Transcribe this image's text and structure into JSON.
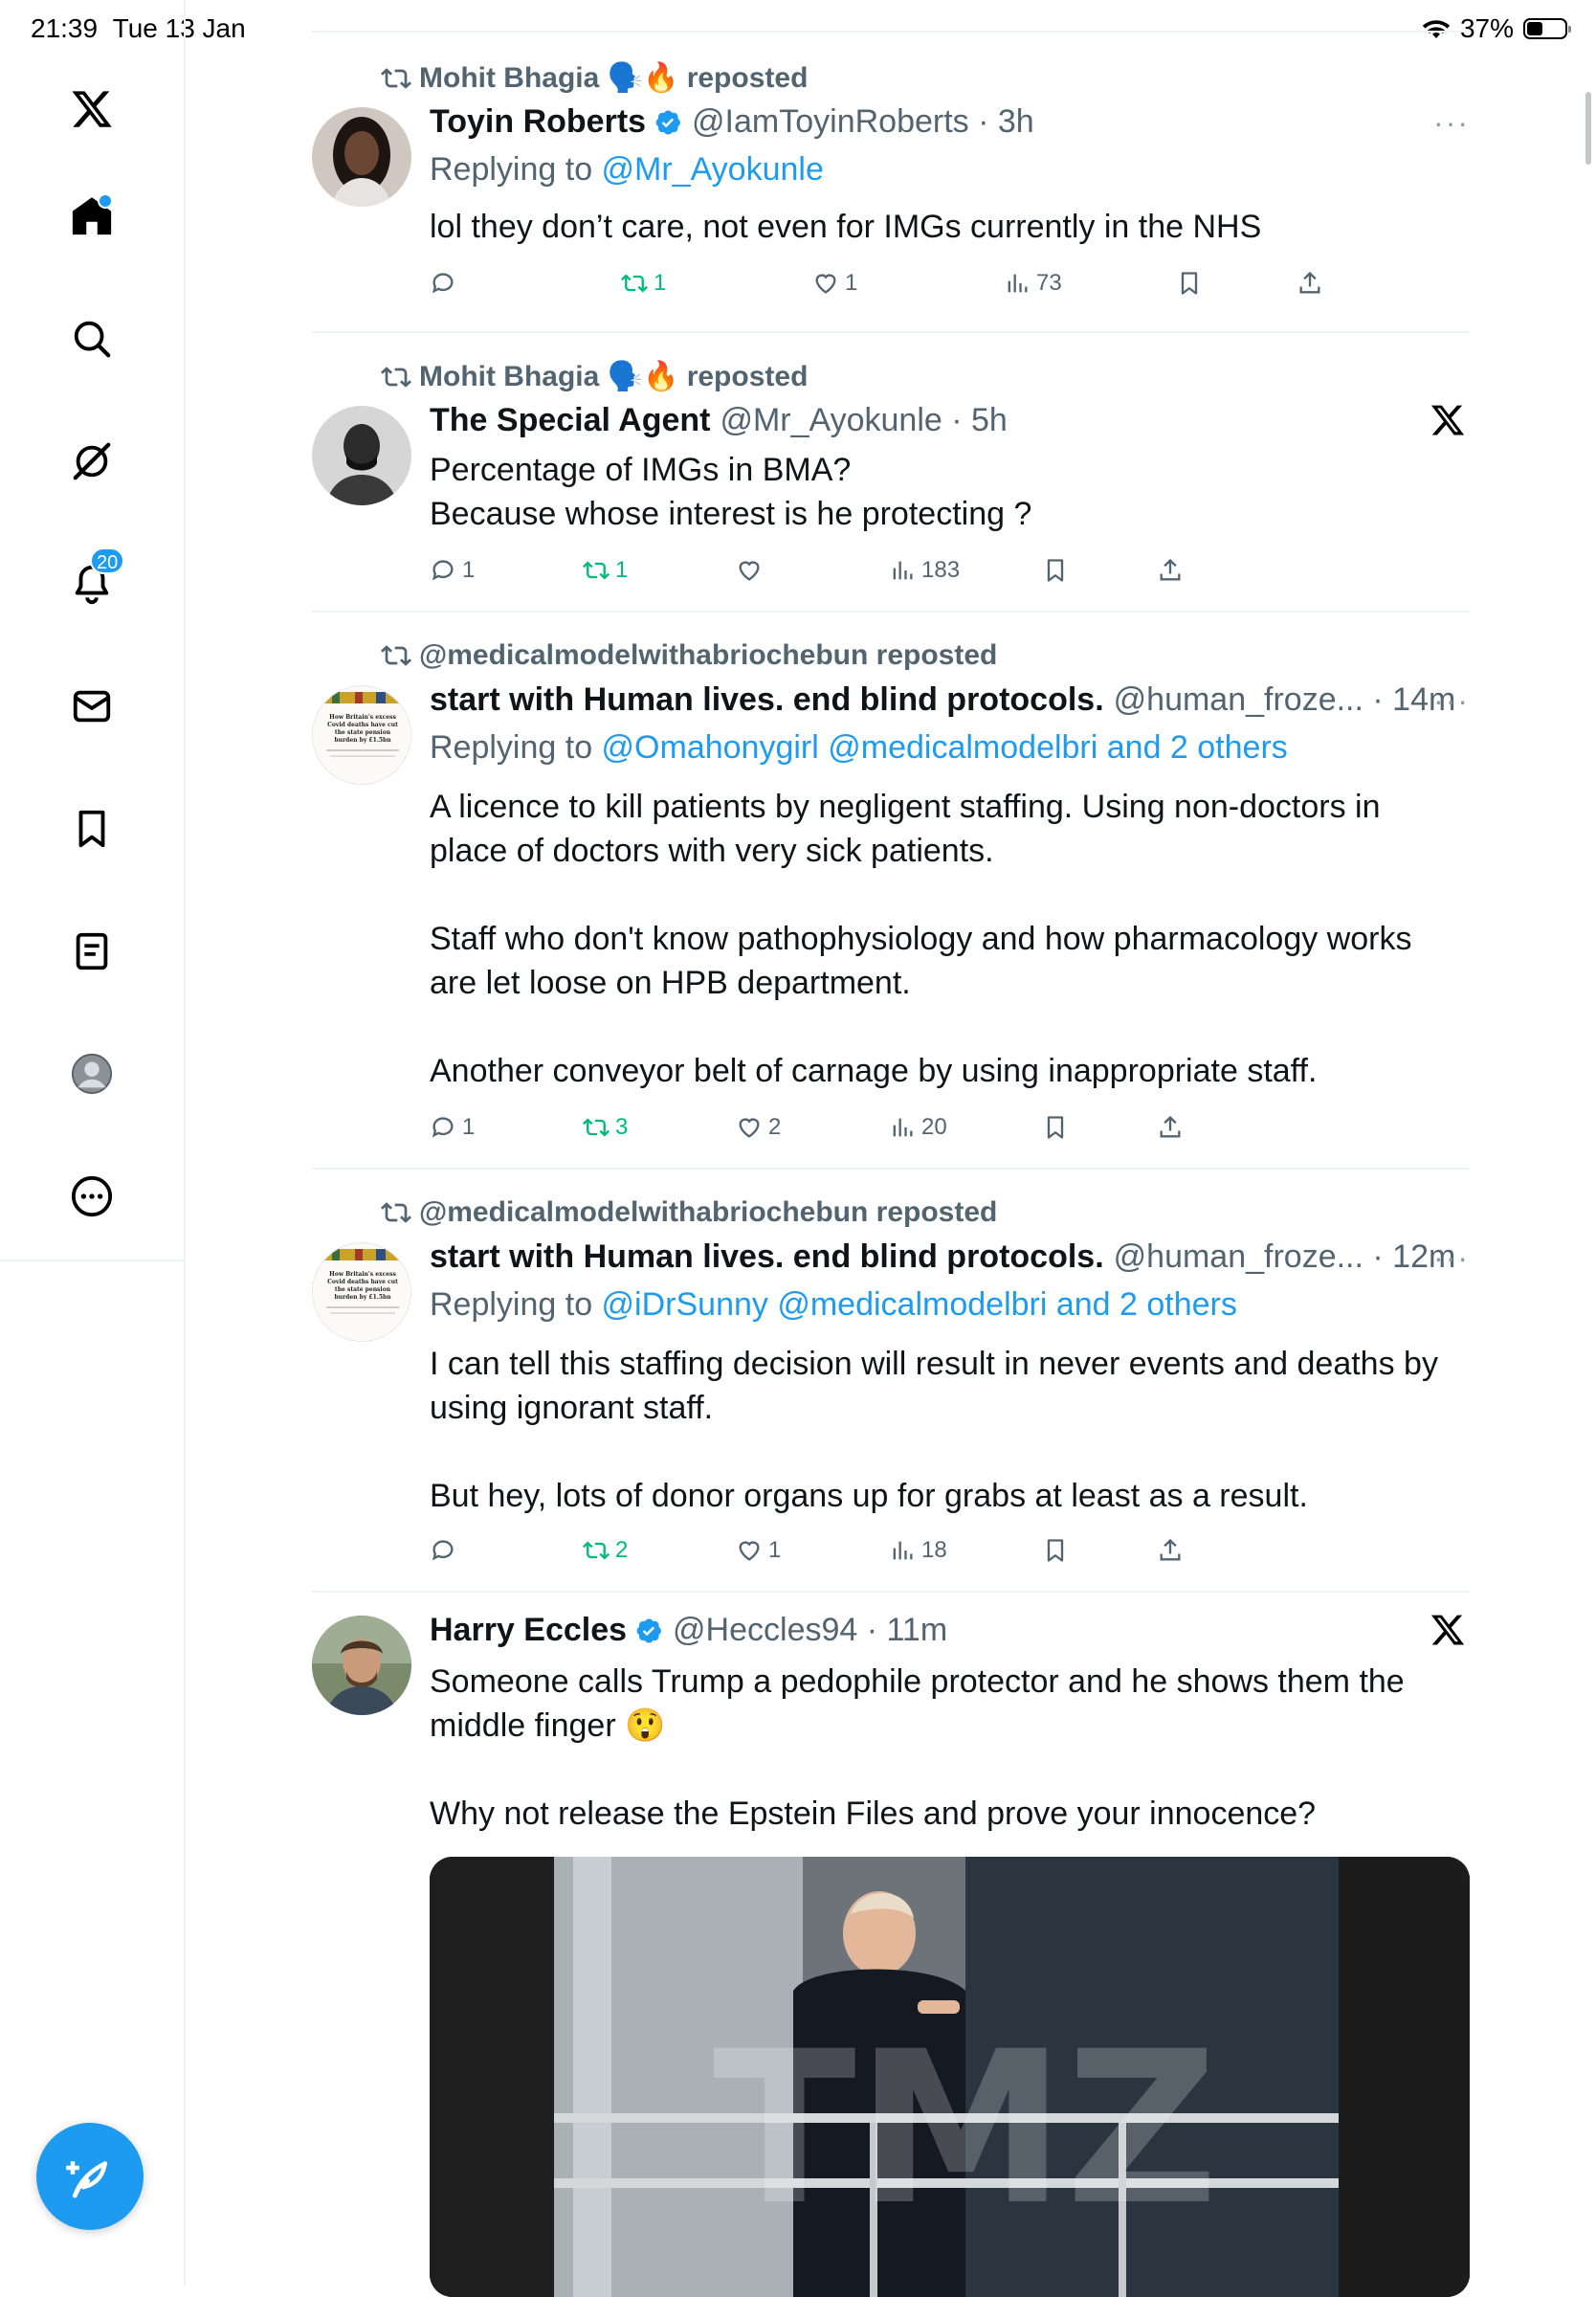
{
  "status_bar": {
    "time": "21:39",
    "date": "Tue 13 Jan",
    "battery": "37%",
    "battery_level": 0.37
  },
  "sidebar": {
    "items": [
      {
        "name": "x-logo"
      },
      {
        "name": "home",
        "has_dot": true
      },
      {
        "name": "explore"
      },
      {
        "name": "grok"
      },
      {
        "name": "notifications",
        "badge": "20"
      },
      {
        "name": "messages"
      },
      {
        "name": "bookmarks"
      },
      {
        "name": "lists"
      },
      {
        "name": "profile"
      },
      {
        "name": "more"
      }
    ]
  },
  "tweets": [
    {
      "repost_by": "Mohit Bhagia 🗣️🔥 reposted",
      "name": "Toyin Roberts",
      "verified": true,
      "handle": "@IamToyinRoberts · 3h",
      "reply_to_prefix": "Replying to ",
      "reply_to": "@Mr_Ayokunle",
      "text": [
        "lol they don’t care, not even for IMGs currently in the NHS"
      ],
      "replies": "",
      "reposts": "1",
      "likes": "1",
      "views": "73"
    },
    {
      "repost_by": "Mohit Bhagia 🗣️🔥 reposted",
      "name": "The Special Agent",
      "verified": false,
      "handle": "@Mr_Ayokunle · 5h",
      "text": [
        "Percentage of IMGs in BMA?",
        "Because whose interest is he protecting ?"
      ],
      "replies": "1",
      "reposts": "1",
      "likes": "",
      "views": "183"
    },
    {
      "repost_by": "@medicalmodelwithabriochebun reposted",
      "name": "start with Human lives. end blind protocols.",
      "verified": false,
      "handle": "@human_froze... · 14m",
      "reply_to_prefix": "Replying to ",
      "reply_to": "@Omahonygirl @medicalmodelbri and 2 others",
      "text": [
        "A licence to kill patients by negligent staffing.  Using non-doctors in place of doctors with very sick patients.",
        "Staff who don't know pathophysiology and how pharmacology works are let loose on HPB department.",
        "Another conveyor belt of carnage by using inappropriate staff."
      ],
      "replies": "1",
      "reposts": "3",
      "likes": "2",
      "views": "20"
    },
    {
      "repost_by": "@medicalmodelwithabriochebun reposted",
      "name": "start with Human lives. end blind protocols.",
      "verified": false,
      "handle": "@human_froze... · 12m",
      "reply_to_prefix": "Replying to ",
      "reply_to": "@iDrSunny @medicalmodelbri and 2 others",
      "text": [
        "I can tell this staffing decision will result in never events and deaths by using ignorant staff.",
        "But hey, lots of donor organs up for grabs at least as a result."
      ],
      "replies": "",
      "reposts": "2",
      "likes": "1",
      "views": "18"
    },
    {
      "name": "Harry Eccles",
      "verified": true,
      "handle": "@Heccles94 · 11m",
      "text": [
        "Someone calls Trump a pedophile protector and he shows them the middle finger 😲",
        "Why not release the Epstein Files and prove your innocence?"
      ],
      "media_watermark": "TMZ"
    }
  ],
  "more_label": "···",
  "avatar_thumb_text": [
    "How Britain's excess",
    "Covid deaths have cut",
    "the state pension",
    "burden by £1.5bn"
  ]
}
